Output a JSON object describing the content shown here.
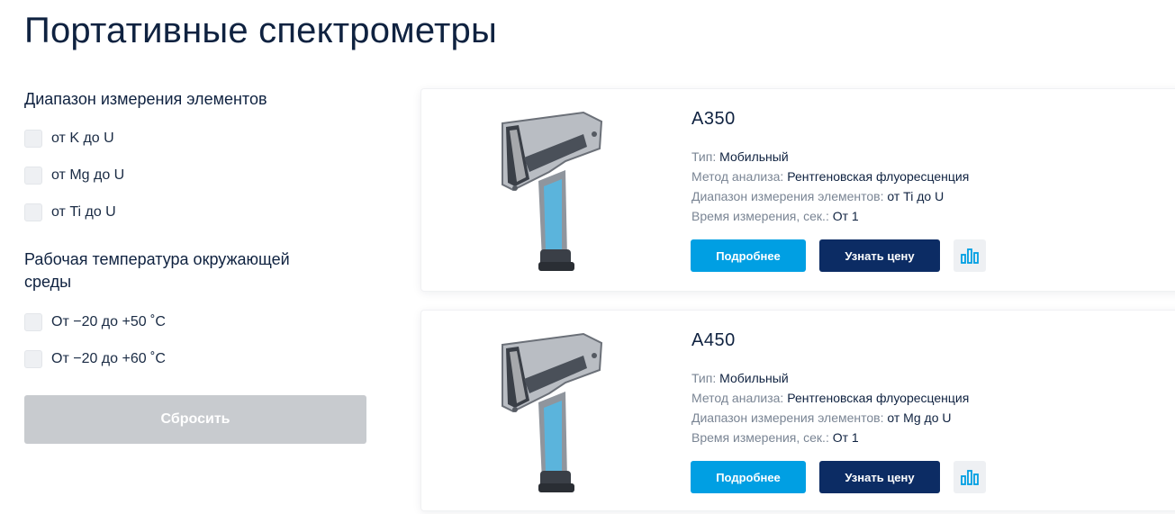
{
  "page": {
    "title": "Портативные спектрометры"
  },
  "filters": {
    "range": {
      "title": "Диапазон измерения элементов",
      "options": [
        "от K до U",
        "от Mg до U",
        "от Ti до U"
      ]
    },
    "temperature": {
      "title": "Рабочая температура окружающей среды",
      "options": [
        "От −20 до +50 ˚C",
        "От −20 до +60 ˚C"
      ]
    },
    "reset_label": "Сбросить"
  },
  "products": [
    {
      "name": "A350",
      "specs": [
        {
          "label": "Тип: ",
          "value": "Мобильный"
        },
        {
          "label": "Метод анализа: ",
          "value": "Рентгеновская флуоресценция"
        },
        {
          "label": "Диапазон измерения элементов: ",
          "value": "от Ti до U"
        },
        {
          "label": "Время измерения, сек.: ",
          "value": "От 1"
        }
      ],
      "more_label": "Подробнее",
      "price_label": "Узнать цену"
    },
    {
      "name": "A450",
      "specs": [
        {
          "label": "Тип: ",
          "value": "Мобильный"
        },
        {
          "label": "Метод анализа: ",
          "value": "Рентгеновская флуоресценция"
        },
        {
          "label": "Диапазон измерения элементов: ",
          "value": "от Mg до U"
        },
        {
          "label": "Время измерения, сек.: ",
          "value": "От 1"
        }
      ],
      "more_label": "Подробнее",
      "price_label": "Узнать цену"
    }
  ],
  "colors": {
    "accent_blue": "#009fe3",
    "navy": "#0c2c64",
    "reset_gray": "#c8cbcf",
    "title_text": "#0f2240"
  },
  "icons": {
    "compare": "bar-chart-icon",
    "product_image": "spectrometer-image"
  }
}
